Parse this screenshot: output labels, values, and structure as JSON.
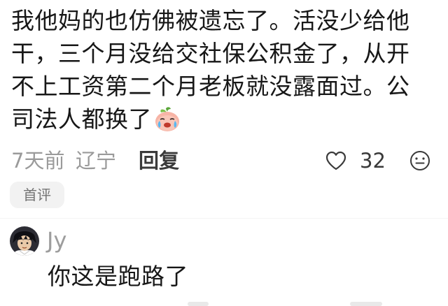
{
  "comment": {
    "text": "我他妈的也仿佛被遗忘了。活没少给他干，三个月没给交社保公积金了，从开不上工资第二个月老板就没露面过。公司法人都换了",
    "emoji": "crying-peach-emoji",
    "time": "7天前",
    "location": "辽宁",
    "reply_label": "回复",
    "like_count": "32",
    "badge": "首评"
  },
  "reply": {
    "username": "Jy",
    "text": "你这是跑路了"
  },
  "icons": {
    "like": "heart-outline-icon",
    "reaction": "emoji-face-icon"
  },
  "colors": {
    "primary_text": "#171717",
    "secondary_text": "#9a9a9a",
    "badge_bg": "#f2f2f2"
  }
}
